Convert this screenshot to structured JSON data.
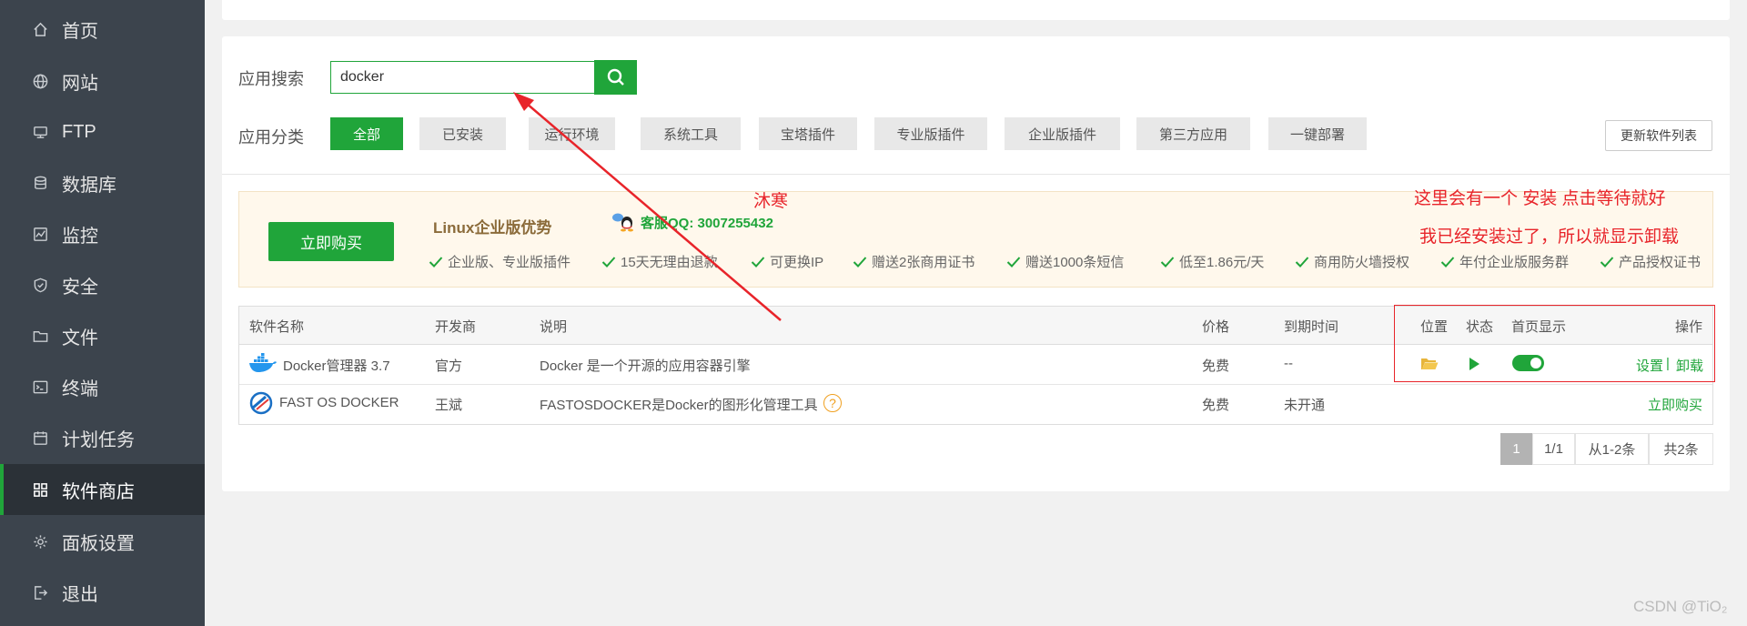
{
  "sidebar": {
    "items": [
      {
        "label": "首页",
        "icon": "home-icon"
      },
      {
        "label": "网站",
        "icon": "globe-icon"
      },
      {
        "label": "FTP",
        "icon": "ftp-icon"
      },
      {
        "label": "数据库",
        "icon": "database-icon"
      },
      {
        "label": "监控",
        "icon": "monitor-icon"
      },
      {
        "label": "安全",
        "icon": "shield-icon"
      },
      {
        "label": "文件",
        "icon": "folder-icon"
      },
      {
        "label": "终端",
        "icon": "terminal-icon"
      },
      {
        "label": "计划任务",
        "icon": "calendar-icon"
      },
      {
        "label": "软件商店",
        "icon": "apps-icon",
        "active": true
      },
      {
        "label": "面板设置",
        "icon": "gear-icon"
      },
      {
        "label": "退出",
        "icon": "logout-icon"
      }
    ]
  },
  "search": {
    "label": "应用搜索",
    "value": "docker"
  },
  "categories": {
    "label": "应用分类",
    "items": [
      "全部",
      "已安装",
      "运行环境",
      "系统工具",
      "宝塔插件",
      "专业版插件",
      "企业版插件",
      "第三方应用",
      "一键部署"
    ],
    "update_label": "更新软件列表"
  },
  "promo": {
    "buy_label": "立即购买",
    "title": "Linux企业版优势",
    "qq": "客服QQ: 3007255432",
    "features": [
      "企业版、专业版插件",
      "15天无理由退款",
      "可更换IP",
      "赠送2张商用证书",
      "赠送1000条短信",
      "低至1.86元/天",
      "商用防火墙授权",
      "年付企业版服务群",
      "产品授权证书"
    ]
  },
  "table": {
    "headers": {
      "name": "软件名称",
      "developer": "开发商",
      "desc": "说明",
      "price": "价格",
      "expire": "到期时间",
      "location": "位置",
      "status": "状态",
      "homepage": "首页显示",
      "ops": "操作"
    },
    "rows": [
      {
        "name": "Docker管理器 3.7",
        "developer": "官方",
        "desc": "Docker 是一个开源的应用容器引擎",
        "price": "免费",
        "expire": "--",
        "settings": "设置",
        "sep": "|",
        "uninstall": "卸载"
      },
      {
        "name": "FAST OS DOCKER",
        "developer": "王斌",
        "desc": "FASTOSDOCKER是Docker的图形化管理工具",
        "help": "?",
        "price": "免费",
        "expire": "未开通",
        "buy": "立即购买"
      }
    ]
  },
  "pager": {
    "current": "1",
    "pages": "1/1",
    "range": "从1-2条",
    "total": "共2条"
  },
  "annotations": {
    "name": "沐寒",
    "note1": "这里会有一个 安装 点击等待就好",
    "note2": "我已经安装过了，所以就显示卸载"
  },
  "watermark": "CSDN @TiO₂",
  "colors": {
    "brand": "#20a53a",
    "sidebar": "#3c444d",
    "annotation": "#e8242a"
  }
}
